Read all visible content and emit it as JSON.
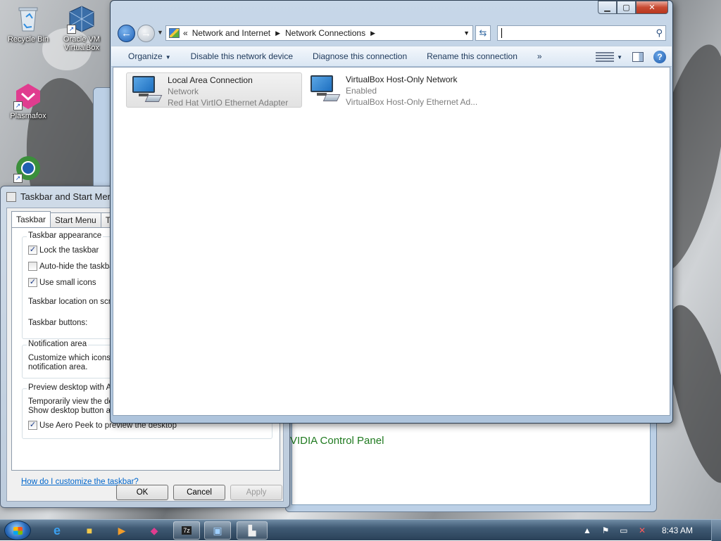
{
  "desktop": {
    "icons": [
      {
        "label": "Recycle Bin",
        "icon": "recycle-bin-icon"
      },
      {
        "label": "Oracle VM VirtualBox",
        "icon": "virtualbox-icon"
      },
      {
        "label": "Plasmafox",
        "icon": "plasmafox-icon"
      },
      {
        "label": "",
        "icon": "browser-icon"
      }
    ]
  },
  "background": {
    "nvidia_label": "VIDIA Control Panel"
  },
  "taskbar_dialog": {
    "title": "Taskbar and Start Menu",
    "tabs": [
      "Taskbar",
      "Start Menu",
      "Tool"
    ],
    "appearance_group": "Taskbar appearance",
    "lock": {
      "label": "Lock the taskbar",
      "checked": true
    },
    "autohide": {
      "label": "Auto-hide the taskbar",
      "checked": false
    },
    "small_icons": {
      "label": "Use small icons",
      "checked": true
    },
    "location_label": "Taskbar location on scree",
    "buttons_label": "Taskbar buttons:",
    "notification_group": "Notification area",
    "notification_text_1": "Customize which icons ar",
    "notification_text_2": "notification area.",
    "preview_group": "Preview desktop with Ae",
    "preview_text_1": "Temporarily view the desk",
    "preview_text_2": "Show desktop button at",
    "aero_peek": {
      "label": "Use Aero Peek to preview the desktop",
      "checked": true
    },
    "help_link": "How do I customize the taskbar?",
    "ok": "OK",
    "cancel": "Cancel",
    "apply": "Apply"
  },
  "explorer": {
    "breadcrumb_overflow": "«",
    "breadcrumb": [
      "Network and Internet",
      "Network Connections"
    ],
    "search_placeholder": "",
    "commands": {
      "organize": "Organize",
      "disable": "Disable this network device",
      "diagnose": "Diagnose this connection",
      "rename": "Rename this connection",
      "more": "»"
    },
    "connections": [
      {
        "name": "Local Area Connection",
        "status": "Network",
        "adapter": "Red Hat VirtIO Ethernet Adapter",
        "selected": true
      },
      {
        "name": "VirtualBox Host-Only Network",
        "status": "Enabled",
        "adapter": "VirtualBox Host-Only Ethernet Ad...",
        "selected": false
      }
    ]
  },
  "tray": {
    "time": "8:43 AM"
  },
  "colors": {
    "link": "#0066cc",
    "nvidia_green": "#1f7a1f",
    "close_red": "#c84a32"
  }
}
